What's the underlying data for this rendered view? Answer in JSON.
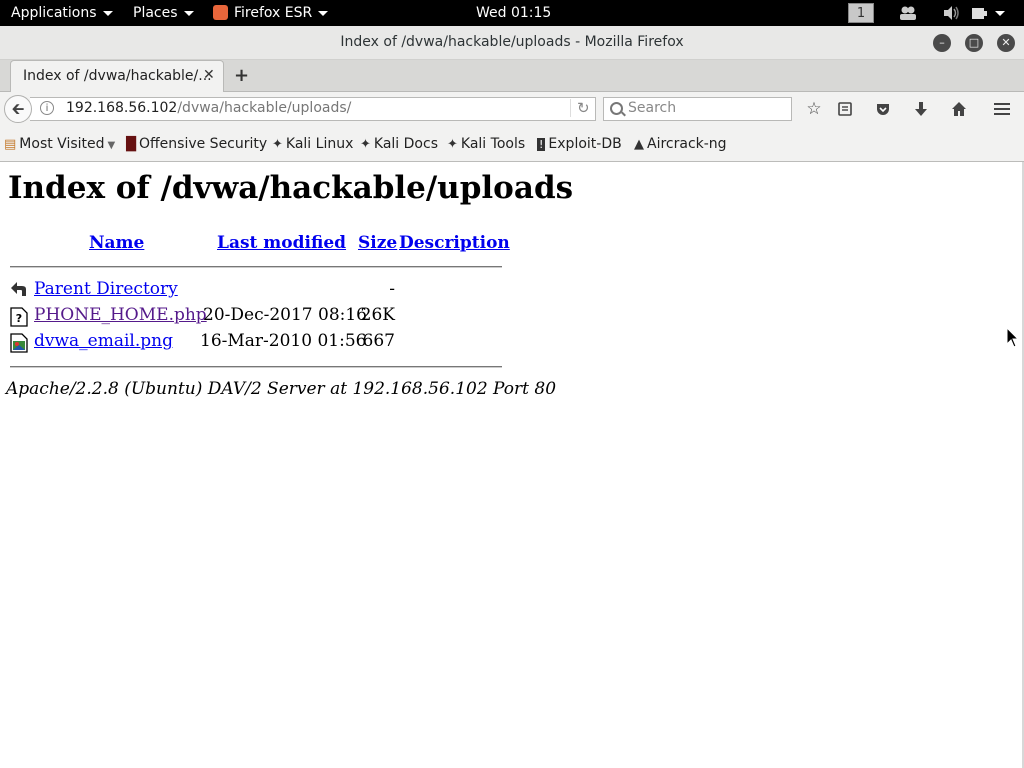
{
  "topbar": {
    "applications": "Applications",
    "places": "Places",
    "firefox": "Firefox ESR",
    "clock": "Wed 01:15",
    "workspace": "1"
  },
  "window": {
    "title": "Index of /dvwa/hackable/uploads - Mozilla Firefox"
  },
  "tab": {
    "label": "Index of /dvwa/hackable/..."
  },
  "navbar": {
    "url_host": "192.168.56.102",
    "url_path": "/dvwa/hackable/uploads/",
    "search_placeholder": "Search"
  },
  "bookmarks": [
    "Most Visited",
    "Offensive Security",
    "Kali Linux",
    "Kali Docs",
    "Kali Tools",
    "Exploit-DB",
    "Aircrack-ng"
  ],
  "page": {
    "heading": "Index of /dvwa/hackable/uploads",
    "columns": {
      "name": "Name",
      "modified": "Last modified",
      "size": "Size",
      "description": "Description"
    },
    "rows": [
      {
        "name": "Parent Directory",
        "modified": "",
        "size": "-",
        "icon": "back-arrow-icon"
      },
      {
        "name": "PHONE_HOME.php",
        "modified": "20-Dec-2017 08:16",
        "size": "26K",
        "icon": "unknown-file-icon"
      },
      {
        "name": "dvwa_email.png",
        "modified": "16-Mar-2010 01:56",
        "size": "667",
        "icon": "image-file-icon"
      }
    ],
    "address": "Apache/2.2.8 (Ubuntu) DAV/2 Server at 192.168.56.102 Port 80"
  }
}
